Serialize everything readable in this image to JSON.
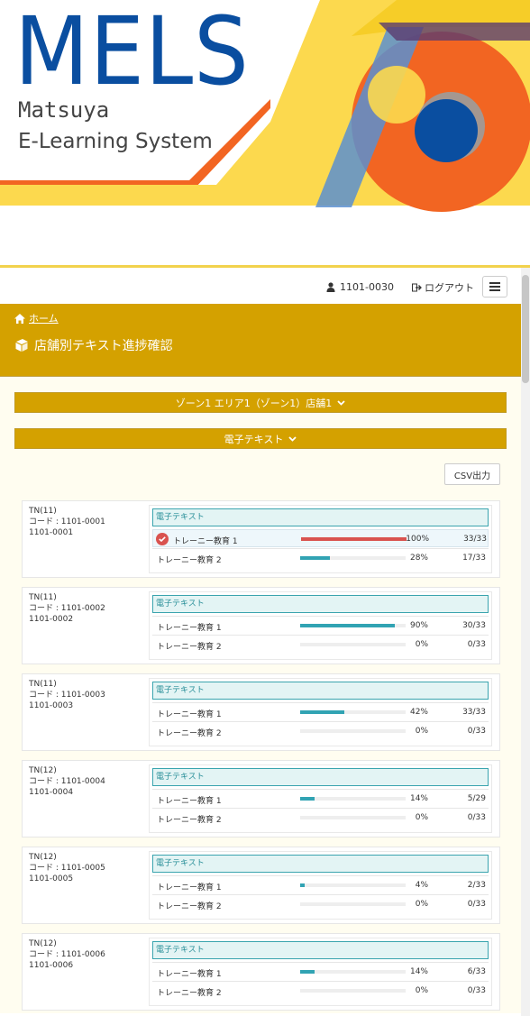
{
  "banner": {
    "logo": "MELS",
    "subtitle1": "Matsuya",
    "subtitle2": "E-Learning System"
  },
  "topbar": {
    "user_id": "1101-0030",
    "logout_label": "ログアウト",
    "icons": {
      "user": "user-icon",
      "logout": "sign-out-icon",
      "menu": "hamburger-icon"
    }
  },
  "header": {
    "breadcrumb_home": "ホーム",
    "page_title": "店舗別テキスト進捗確認"
  },
  "filters": {
    "store_select": "ゾーン1 エリア1（ゾーン1）店舗1",
    "text_type_select": "電子テキスト"
  },
  "csv_label": "CSV出力",
  "colors": {
    "accent": "#d4a100",
    "progress": "#31a3b3",
    "complete": "#d9534f",
    "category_bg": "#e3f4f4"
  },
  "trainees": [
    {
      "group": "TN(11)",
      "code": "コード : 1101-0001",
      "id": "1101-0001",
      "category": "電子テキスト",
      "courses": [
        {
          "name": "トレーニー教育 1",
          "progress": 1.0,
          "percent": "100%",
          "count": "33/33",
          "complete": true
        },
        {
          "name": "トレーニー教育 2",
          "progress": 0.28,
          "percent": "28%",
          "count": "17/33",
          "complete": false
        }
      ]
    },
    {
      "group": "TN(11)",
      "code": "コード : 1101-0002",
      "id": "1101-0002",
      "category": "電子テキスト",
      "courses": [
        {
          "name": "トレーニー教育 1",
          "progress": 0.9,
          "percent": "90%",
          "count": "30/33",
          "complete": false
        },
        {
          "name": "トレーニー教育 2",
          "progress": 0,
          "percent": "0%",
          "count": "0/33",
          "complete": false
        }
      ]
    },
    {
      "group": "TN(11)",
      "code": "コード : 1101-0003",
      "id": "1101-0003",
      "category": "電子テキスト",
      "courses": [
        {
          "name": "トレーニー教育 1",
          "progress": 0.42,
          "percent": "42%",
          "count": "33/33",
          "complete": false
        },
        {
          "name": "トレーニー教育 2",
          "progress": 0,
          "percent": "0%",
          "count": "0/33",
          "complete": false
        }
      ]
    },
    {
      "group": "TN(12)",
      "code": "コード : 1101-0004",
      "id": "1101-0004",
      "category": "電子テキスト",
      "courses": [
        {
          "name": "トレーニー教育 1",
          "progress": 0.14,
          "percent": "14%",
          "count": "5/29",
          "complete": false
        },
        {
          "name": "トレーニー教育 2",
          "progress": 0,
          "percent": "0%",
          "count": "0/33",
          "complete": false
        }
      ]
    },
    {
      "group": "TN(12)",
      "code": "コード : 1101-0005",
      "id": "1101-0005",
      "category": "電子テキスト",
      "courses": [
        {
          "name": "トレーニー教育 1",
          "progress": 0.04,
          "percent": "4%",
          "count": "2/33",
          "complete": false
        },
        {
          "name": "トレーニー教育 2",
          "progress": 0,
          "percent": "0%",
          "count": "0/33",
          "complete": false
        }
      ]
    },
    {
      "group": "TN(12)",
      "code": "コード : 1101-0006",
      "id": "1101-0006",
      "category": "電子テキスト",
      "courses": [
        {
          "name": "トレーニー教育 1",
          "progress": 0.14,
          "percent": "14%",
          "count": "6/33",
          "complete": false
        },
        {
          "name": "トレーニー教育 2",
          "progress": 0,
          "percent": "0%",
          "count": "0/33",
          "complete": false
        }
      ]
    }
  ]
}
